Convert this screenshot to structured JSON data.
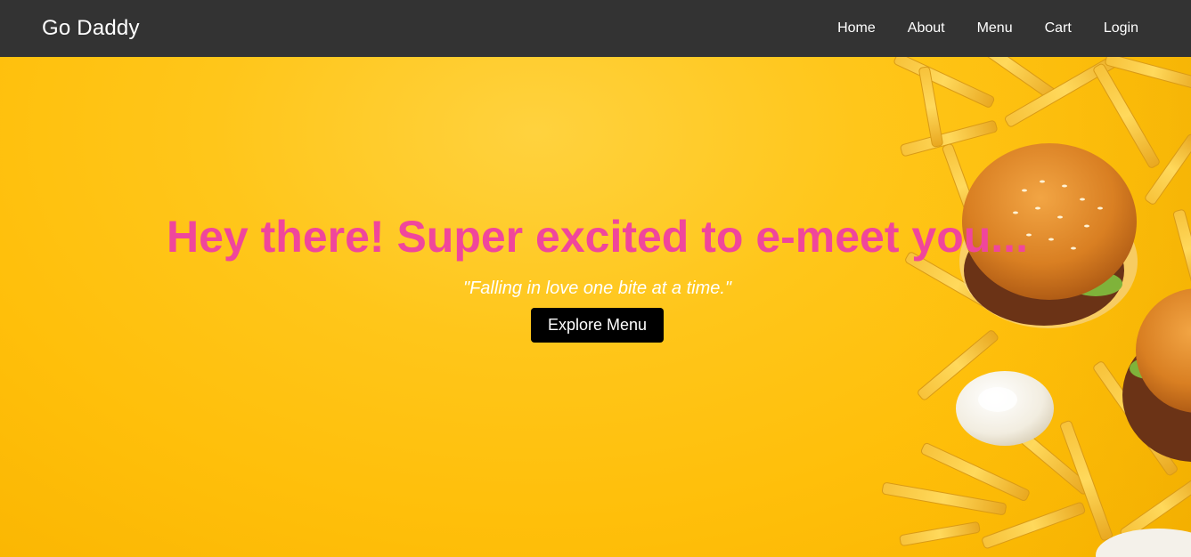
{
  "navbar": {
    "brand": "Go Daddy",
    "links": [
      {
        "label": "Home"
      },
      {
        "label": "About"
      },
      {
        "label": "Menu"
      },
      {
        "label": "Cart"
      },
      {
        "label": "Login"
      }
    ]
  },
  "hero": {
    "title": "Hey there! Super excited to e-meet you...",
    "tagline": "\"Falling in love one bite at a time.\"",
    "button_label": "Explore Menu",
    "image_description_icon": "burgers-and-fries-image"
  },
  "colors": {
    "navbar_bg": "#333333",
    "hero_bg": "#ffc61a",
    "title": "#f0469c",
    "button_bg": "#000000"
  }
}
